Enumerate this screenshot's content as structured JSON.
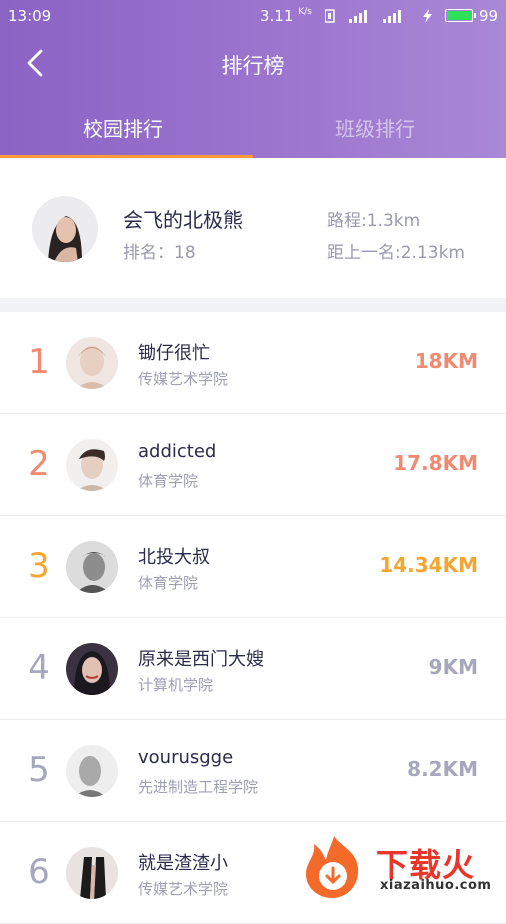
{
  "status_bar": {
    "time": "13:09",
    "net_speed": "3.11",
    "net_unit": "K/s",
    "battery": "99"
  },
  "header": {
    "title": "排行榜",
    "tabs": [
      {
        "label": "校园排行",
        "active": true
      },
      {
        "label": "班级排行",
        "active": false
      }
    ]
  },
  "me": {
    "name": "会飞的北极熊",
    "rank_label": "排名：18",
    "distance": "路程:1.3km",
    "gap": "距上一名:2.13km"
  },
  "list": [
    {
      "rank": "1",
      "name": "锄仔很忙",
      "school": "传媒艺术学院",
      "km": "18KM",
      "rank_color": "#f08a72",
      "km_color": "#f08a72"
    },
    {
      "rank": "2",
      "name": "addicted",
      "school": "体育学院",
      "km": "17.8KM",
      "rank_color": "#f08a72",
      "km_color": "#f08a72"
    },
    {
      "rank": "3",
      "name": "北投大叔",
      "school": "体育学院",
      "km": "14.34KM",
      "rank_color": "#f5a531",
      "km_color": "#f5a531"
    },
    {
      "rank": "4",
      "name": "原来是西门大嫂",
      "school": "计算机学院",
      "km": "9KM",
      "rank_color": "#a6a7bc",
      "km_color": "#a6a7bc"
    },
    {
      "rank": "5",
      "name": "vourusgge",
      "school": "先进制造工程学院",
      "km": "8.2KM",
      "rank_color": "#a6a7bc",
      "km_color": "#a6a7bc"
    },
    {
      "rank": "6",
      "name": "就是渣渣小",
      "school": "传媒艺术学院",
      "km": "",
      "rank_color": "#a6a7bc",
      "km_color": "#a6a7bc"
    }
  ],
  "watermark": {
    "text": "下载火",
    "sub": "xiazaihuo.com"
  },
  "colors": {
    "header_start": "#8a63c4",
    "header_end": "#a988d6",
    "tab_indicator": "#ff9a3c"
  }
}
